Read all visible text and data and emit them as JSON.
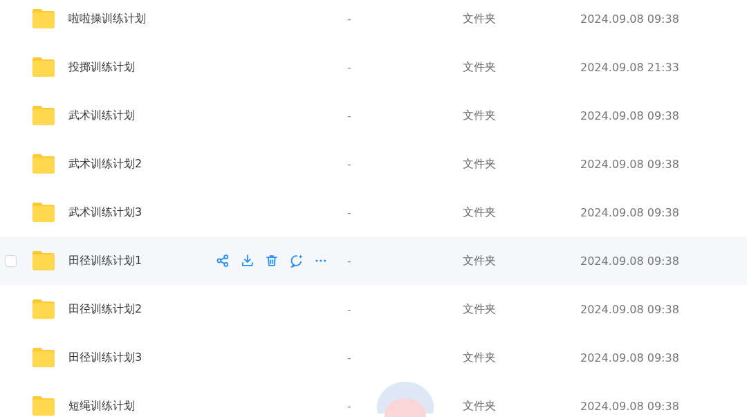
{
  "files": [
    {
      "name": "啦啦操训练计划",
      "size": "-",
      "type": "文件夹",
      "modified": "2024.09.08 09:38",
      "hovered": false,
      "checked": false
    },
    {
      "name": "投掷训练计划",
      "size": "-",
      "type": "文件夹",
      "modified": "2024.09.08 21:33",
      "hovered": false,
      "checked": false
    },
    {
      "name": "武术训练计划",
      "size": "-",
      "type": "文件夹",
      "modified": "2024.09.08 09:38",
      "hovered": false,
      "checked": false
    },
    {
      "name": "武术训练计划2",
      "size": "-",
      "type": "文件夹",
      "modified": "2024.09.08 09:38",
      "hovered": false,
      "checked": false
    },
    {
      "name": "武术训练计划3",
      "size": "-",
      "type": "文件夹",
      "modified": "2024.09.08 09:38",
      "hovered": false,
      "checked": false
    },
    {
      "name": "田径训练计划1",
      "size": "-",
      "type": "文件夹",
      "modified": "2024.09.08 09:38",
      "hovered": true,
      "checked": false
    },
    {
      "name": "田径训练计划2",
      "size": "-",
      "type": "文件夹",
      "modified": "2024.09.08 09:38",
      "hovered": false,
      "checked": false
    },
    {
      "name": "田径训练计划3",
      "size": "-",
      "type": "文件夹",
      "modified": "2024.09.08 09:38",
      "hovered": false,
      "checked": false
    },
    {
      "name": "短绳训练计划",
      "size": "-",
      "type": "文件夹",
      "modified": "2024.09.08 09:38",
      "hovered": false,
      "checked": false
    }
  ]
}
